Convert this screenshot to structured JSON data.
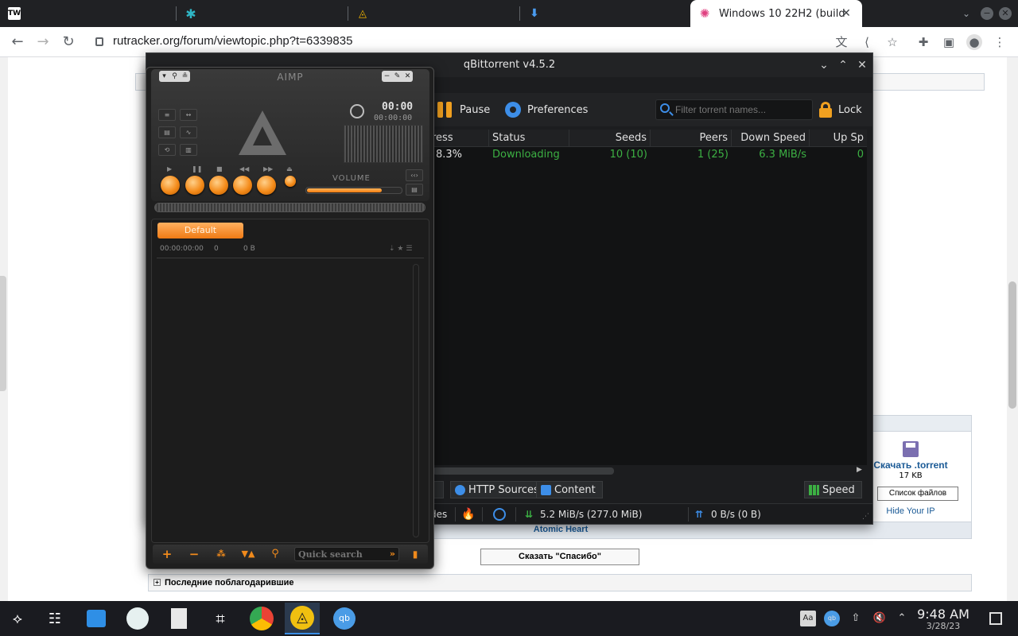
{
  "browser": {
    "tabs": [
      {
        "favicon": "TW",
        "label": ""
      },
      {
        "favicon": "puzzle-icon",
        "label": ""
      },
      {
        "favicon": "aimp-icon",
        "label": ""
      },
      {
        "favicon": "download-icon",
        "label": ""
      },
      {
        "favicon": "pinwheel-icon",
        "label": "Windows 10 22H2 (build",
        "active": true
      }
    ],
    "url": "rutracker.org/forum/viewtopic.php?t=6339835"
  },
  "webpage": {
    "download_link": "Скачать .torrent",
    "download_size": "17 KB",
    "file_list_button": "Список файлов",
    "hide_ip_link": "Hide Your IP",
    "game_title": "Atomic Heart",
    "thanks_button": "Сказать \"Спасибо\"",
    "last_thanks_label": "Последние поблагодарившие"
  },
  "qbittorrent": {
    "title": "qBittorrent v4.5.2",
    "toolbar": {
      "pause_label": "Pause",
      "preferences_label": "Preferences",
      "search_placeholder": "Filter torrent names...",
      "lock_label": "Lock"
    },
    "columns": [
      "ress",
      "Status",
      "Seeds",
      "Peers",
      "Down Speed",
      "Up Sp"
    ],
    "rows": [
      {
        "progress": "8.3%",
        "status": "Downloading",
        "seeds": "10 (10)",
        "peers": "1 (25)",
        "down_speed": "6.3 MiB/s",
        "up_speed": "0"
      }
    ],
    "bottom_tabs": {
      "http_sources": "HTTP Sources",
      "content": "Content",
      "speed": "Speed"
    },
    "status_bar": {
      "nodes_fragment": "des",
      "download": "5.2 MiB/s (277.0 MiB)",
      "upload": "0 B/s (0 B)"
    },
    "colors": {
      "accent": "#f0a020",
      "status_green": "#3cb043",
      "blue": "#3d8ee8"
    }
  },
  "aimp": {
    "title": "AIMP",
    "time": "00:00",
    "time_remaining": "00:00:00",
    "volume_label": "VOLUME",
    "volume_level": 0.8,
    "playlist_tab": "Default",
    "playlist_duration": "00:00:00:00",
    "playlist_count": "0",
    "playlist_size": "0 B",
    "quick_search_placeholder": "Quick search",
    "colors": {
      "accent": "#f08a1c"
    }
  },
  "taskbar": {
    "time": "9:48 AM",
    "date": "3/28/23"
  }
}
